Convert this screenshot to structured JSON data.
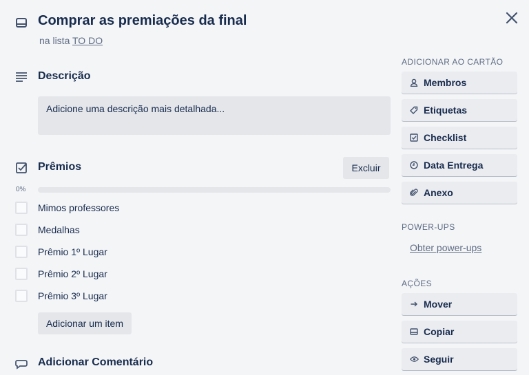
{
  "card": {
    "title": "Comprar as premiações da final",
    "list_prefix": "na lista",
    "list_name": "TO DO"
  },
  "description": {
    "heading": "Descrição",
    "placeholder": "Adicione uma descrição mais detalhada..."
  },
  "checklist": {
    "title": "Prêmios",
    "delete_label": "Excluir",
    "progress_label": "0%",
    "progress": 0,
    "items": [
      {
        "label": "Mimos professores",
        "checked": false
      },
      {
        "label": "Medalhas",
        "checked": false
      },
      {
        "label": "Prêmio 1º Lugar",
        "checked": false
      },
      {
        "label": "Prêmio 2º Lugar",
        "checked": false
      },
      {
        "label": "Prêmio 3º Lugar",
        "checked": false
      }
    ],
    "add_item_label": "Adicionar um item"
  },
  "comment": {
    "heading": "Adicionar Comentário"
  },
  "sidebar": {
    "add_to_card_heading": "ADICIONAR AO CARTÃO",
    "add_to_card": [
      {
        "label": "Membros",
        "icon": "user-icon"
      },
      {
        "label": "Etiquetas",
        "icon": "tag-icon"
      },
      {
        "label": "Checklist",
        "icon": "checkbox-icon"
      },
      {
        "label": "Data Entrega",
        "icon": "clock-icon"
      },
      {
        "label": "Anexo",
        "icon": "paperclip-icon"
      }
    ],
    "powerups_heading": "POWER-UPS",
    "powerups_link": "Obter power-ups",
    "actions_heading": "AÇÕES",
    "actions": [
      {
        "label": "Mover",
        "icon": "arrow-right-icon"
      },
      {
        "label": "Copiar",
        "icon": "copy-icon"
      },
      {
        "label": "Seguir",
        "icon": "eye-icon"
      }
    ]
  },
  "colors": {
    "background": "#f4f5f7",
    "button_bg": "#ebecf0",
    "text": "#172b4d",
    "muted": "#5e6c84"
  }
}
